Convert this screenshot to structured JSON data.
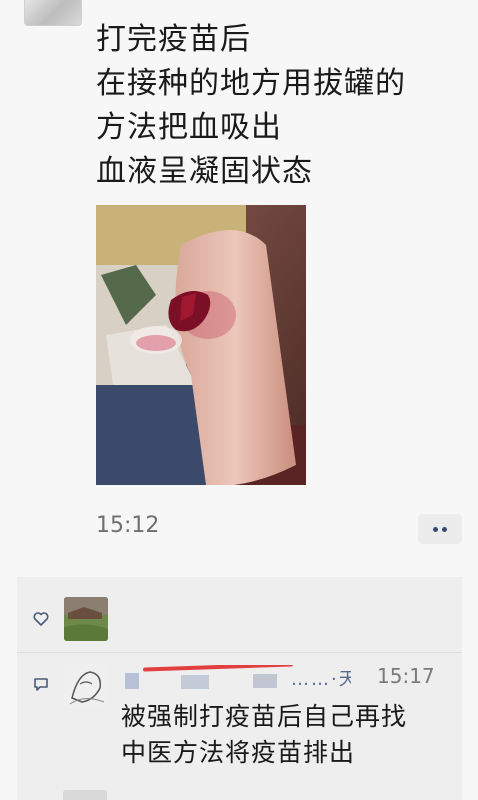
{
  "post": {
    "lines": [
      "打完疫苗后",
      "在接种的地方用拔罐的",
      "方法把血吸出",
      "血液呈凝固状态"
    ],
    "time": "15:12"
  },
  "icons": {
    "like": "heart-icon",
    "comment": "comment-icon",
    "more": "more-dots-icon"
  },
  "comment": {
    "name": "……·天…",
    "time": "15:17",
    "lines": [
      "被强制打疫苗后自己再找",
      "中医方法将疫苗排出"
    ]
  },
  "colors": {
    "name_link": "#5b6b8c",
    "text": "#1a1a1a",
    "time": "#6f6f6f",
    "panel": "#eeeeee"
  }
}
